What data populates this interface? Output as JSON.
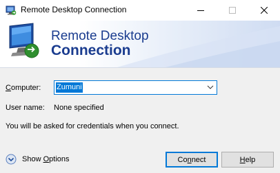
{
  "window": {
    "title": "Remote Desktop Connection"
  },
  "banner": {
    "line1": "Remote Desktop",
    "line2": "Connection"
  },
  "form": {
    "computer_label_accel": "C",
    "computer_label_rest": "omputer:",
    "computer_value": "Zumuni",
    "username_label": "User name:",
    "username_value": "None specified",
    "credentials_hint": "You will be asked for credentials when you connect."
  },
  "footer": {
    "show_options_pre": "Show ",
    "show_options_accel": "O",
    "show_options_rest": "ptions",
    "connect_pre": "Co",
    "connect_accel": "n",
    "connect_rest": "nect",
    "help_accel": "H",
    "help_rest": "elp"
  },
  "icons": {
    "app": "remote-desktop-icon",
    "banner": "monitor-connection-icon",
    "minimize": "minimize-icon",
    "maximize": "maximize-icon",
    "close": "close-icon",
    "dropdown": "chevron-down-icon",
    "show_options": "chevron-circle-down-icon"
  },
  "colors": {
    "accent": "#0078d7",
    "banner_text": "#1a3c8f"
  }
}
